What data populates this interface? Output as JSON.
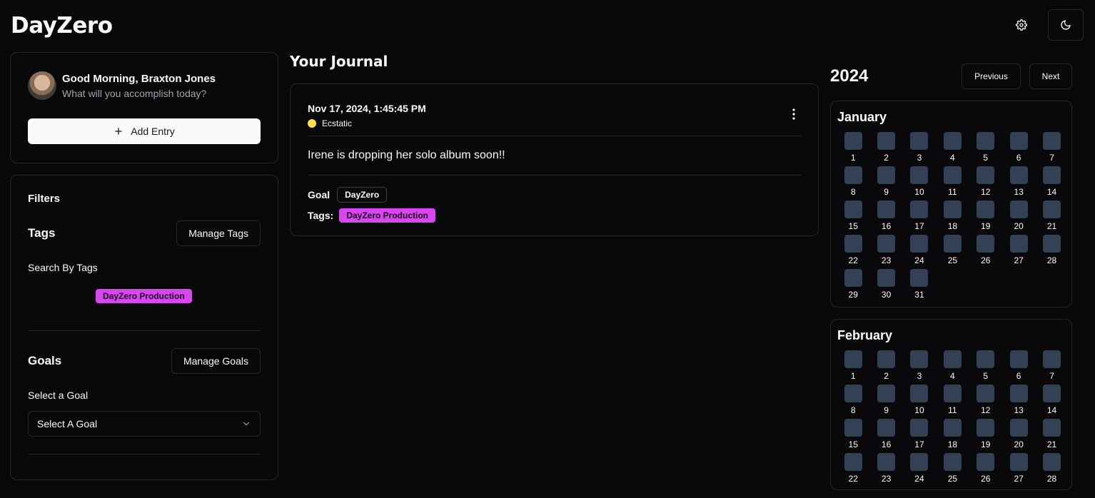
{
  "app": {
    "logo": "DayZero"
  },
  "header": {
    "settings_icon": "gear-icon",
    "theme_icon": "moon-icon"
  },
  "welcome": {
    "greeting": "Good Morning, Braxton Jones",
    "subtitle": "What will you accomplish today?",
    "add_entry_label": "Add Entry"
  },
  "filters": {
    "title": "Filters",
    "tags_title": "Tags",
    "manage_tags_label": "Manage Tags",
    "search_by_tags_label": "Search By Tags",
    "tag_options": [
      "DayZero Production"
    ],
    "goals_title": "Goals",
    "manage_goals_label": "Manage Goals",
    "select_goal_label": "Select a Goal",
    "select_goal_value": "Select A Goal"
  },
  "journal": {
    "title": "Your Journal",
    "entries": [
      {
        "date": "Nov 17, 2024, 1:45:45 PM",
        "mood": "Ecstatic",
        "mood_color": "#fde047",
        "text": "Irene is dropping her solo album soon!!",
        "goal_label": "Goal",
        "goal": "DayZero",
        "tags_label": "Tags:",
        "tags": [
          "DayZero Production"
        ]
      }
    ]
  },
  "calendar": {
    "year": "2024",
    "previous_label": "Previous",
    "next_label": "Next",
    "months": [
      {
        "name": "January",
        "days": 31
      },
      {
        "name": "February",
        "days": 28
      }
    ]
  },
  "colors": {
    "accent_tag": "#d946ef",
    "day_cell": "#334155",
    "background": "#09090b"
  }
}
